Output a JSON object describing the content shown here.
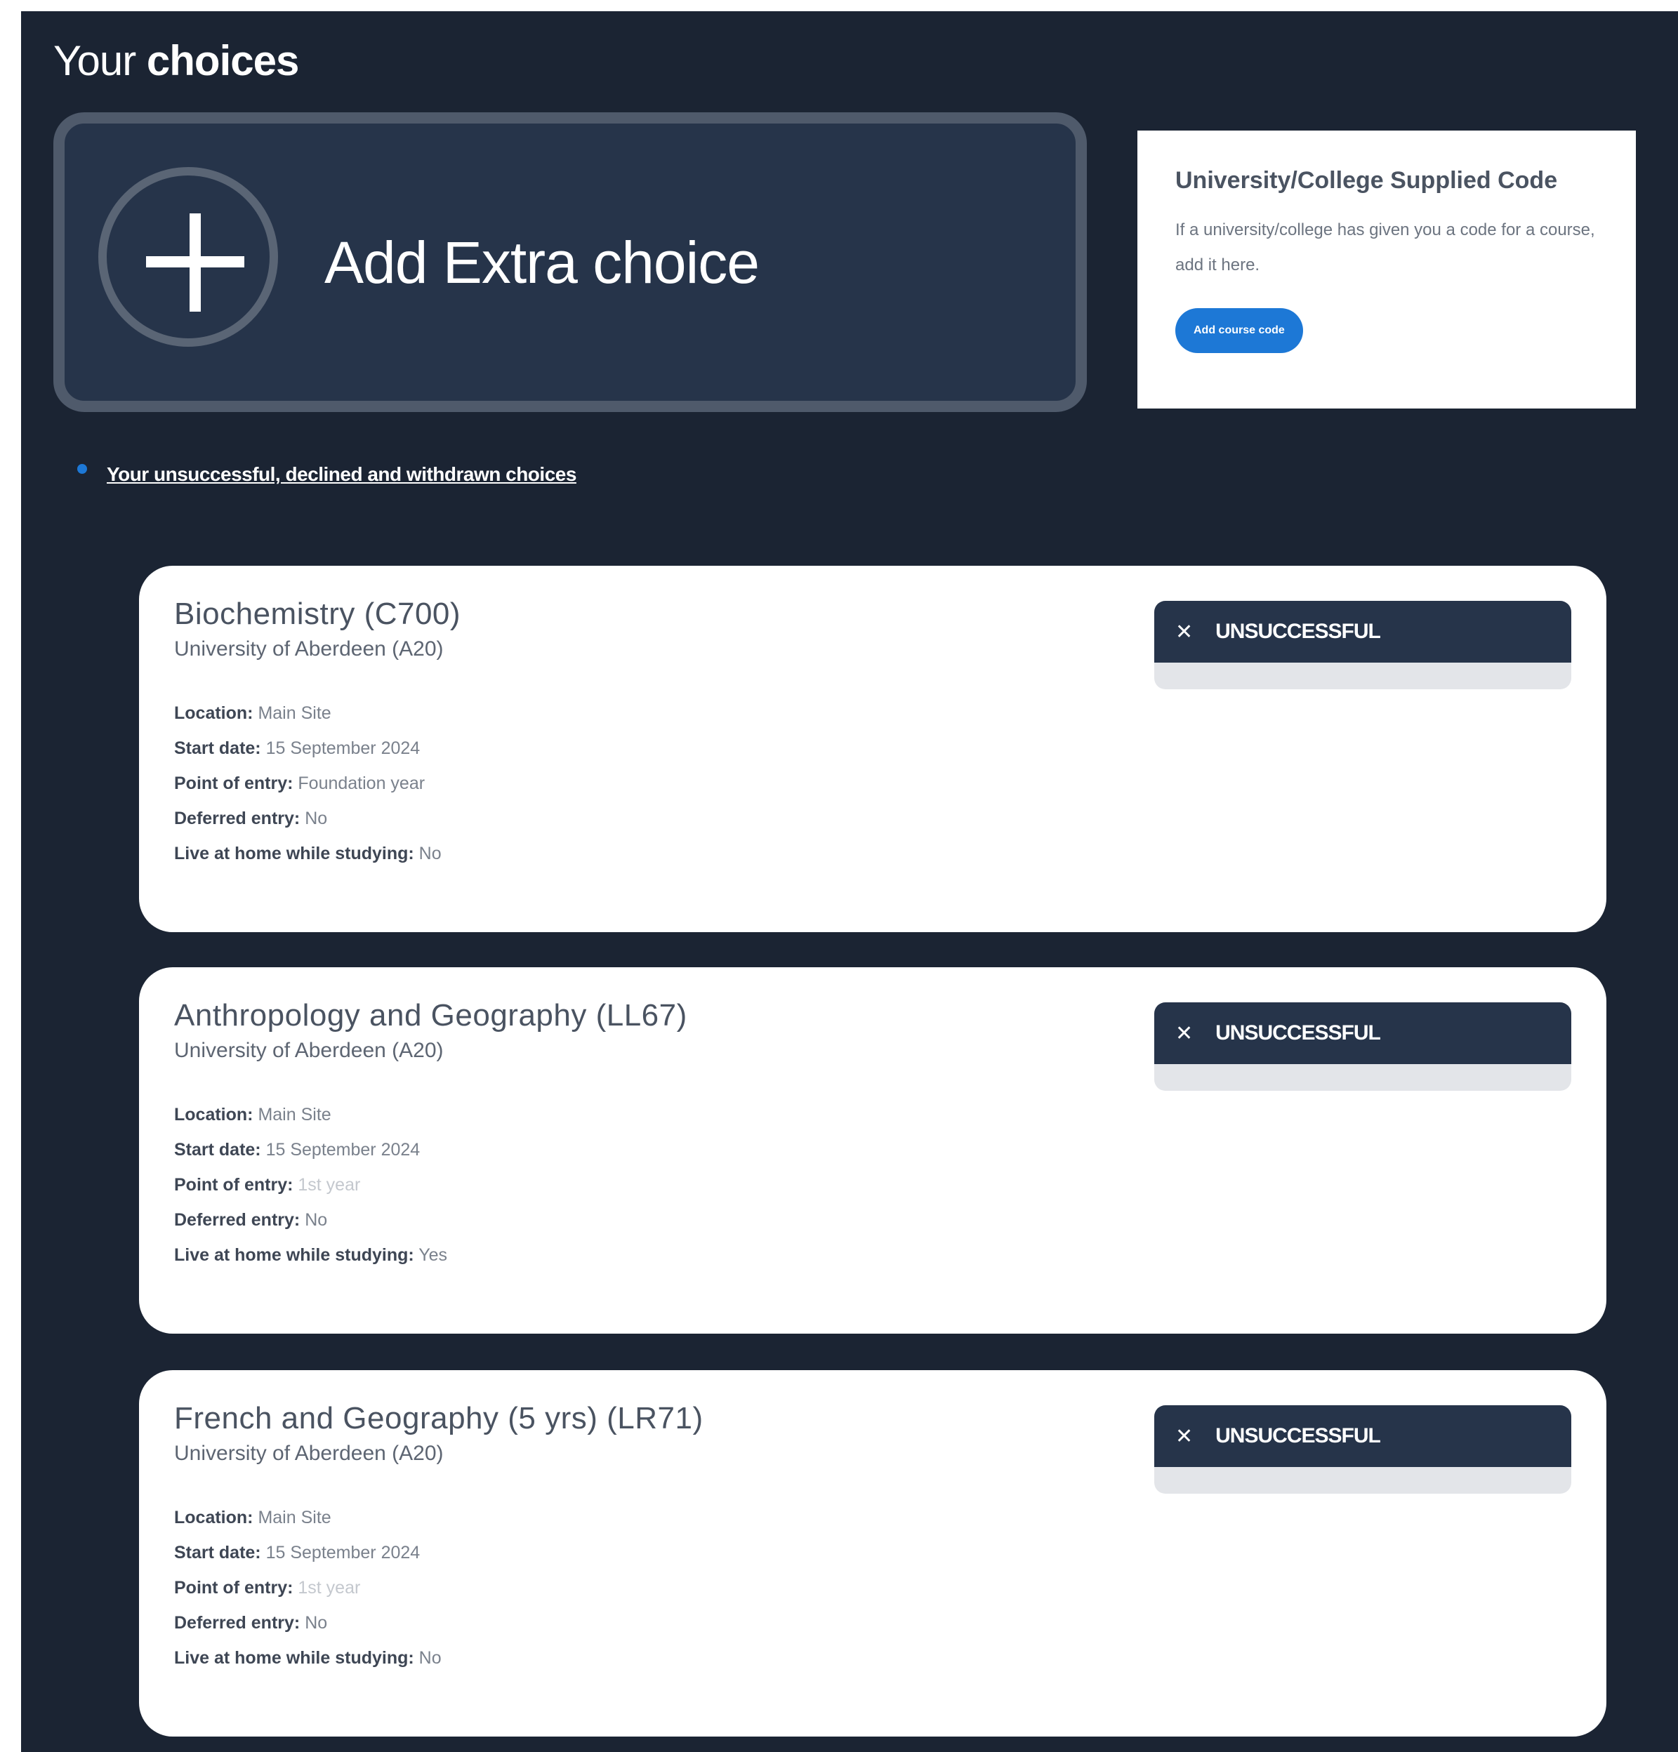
{
  "page": {
    "title_light": "Your",
    "title_bold": "choices"
  },
  "add_extra": {
    "label": "Add Extra choice"
  },
  "supplied_code": {
    "title": "University/College Supplied Code",
    "description": "If a university/college has given you a code for a course, add it here.",
    "button_label": "Add course code"
  },
  "unsuccessful_link": "Your unsuccessful, declined and withdrawn choices",
  "choices": [
    {
      "title": "Biochemistry (C700)",
      "university": "University of Aberdeen (A20)",
      "status": "UNSUCCESSFUL",
      "location_label": "Location:",
      "location": "Main Site",
      "start_label": "Start date:",
      "start": "15 September 2024",
      "entry_label": "Point of entry:",
      "entry": "Foundation year",
      "deferred_label": "Deferred entry:",
      "deferred": "No",
      "home_label": "Live at home while studying:",
      "home": "No"
    },
    {
      "title": "Anthropology and Geography (LL67)",
      "university": "University of Aberdeen (A20)",
      "status": "UNSUCCESSFUL",
      "location_label": "Location:",
      "location": "Main Site",
      "start_label": "Start date:",
      "start": "15 September 2024",
      "entry_label": "Point of entry:",
      "entry": "1st year",
      "deferred_label": "Deferred entry:",
      "deferred": "No",
      "home_label": "Live at home while studying:",
      "home": "Yes"
    },
    {
      "title": "French and Geography (5 yrs) (LR71)",
      "university": "University of Aberdeen (A20)",
      "status": "UNSUCCESSFUL",
      "location_label": "Location:",
      "location": "Main Site",
      "start_label": "Start date:",
      "start": "15 September 2024",
      "entry_label": "Point of entry:",
      "entry": "1st year",
      "deferred_label": "Deferred entry:",
      "deferred": "No",
      "home_label": "Live at home while studying:",
      "home": "No"
    }
  ],
  "icons": {
    "close": "close-icon",
    "plus": "plus-icon"
  },
  "colors": {
    "panel_bg": "#1b2433",
    "accent": "#1d78d6",
    "badge_bg": "#26344a"
  }
}
